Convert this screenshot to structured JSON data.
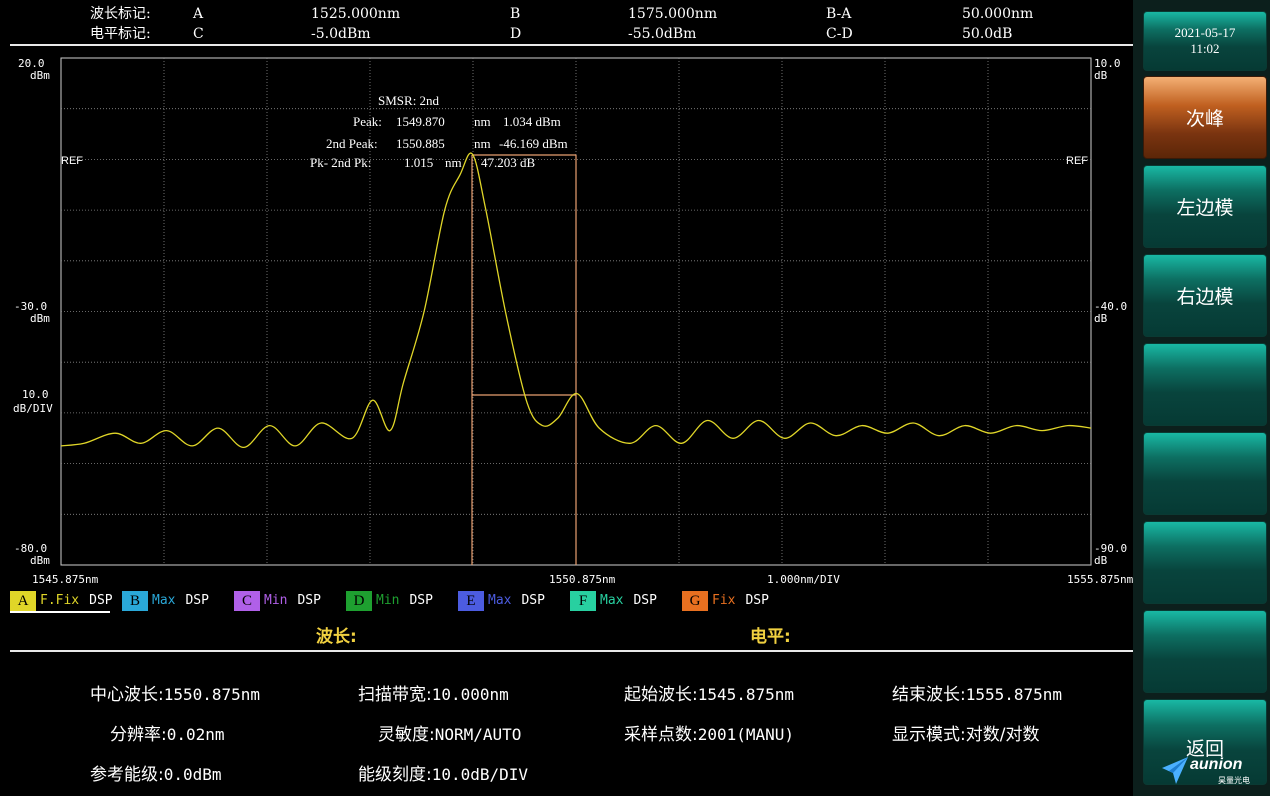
{
  "header": {
    "row1": {
      "label": "波长标记:",
      "m1_name": "A",
      "m1_value": "1525.000nm",
      "m2_name": "B",
      "m2_value": "1575.000nm",
      "diff_name": "B-A",
      "diff_value": "50.000nm"
    },
    "row2": {
      "label": "电平标记:",
      "m1_name": "C",
      "m1_value": "-5.0dBm",
      "m2_name": "D",
      "m2_value": "-55.0dBm",
      "diff_name": "C-D",
      "diff_value": "50.0dB"
    }
  },
  "plot": {
    "left_axis": {
      "top": "20.0",
      "top_unit": "dBm",
      "mid": "-30.0",
      "mid_unit": "dBm",
      "scale": "10.0",
      "scale_unit": "dB/DIV",
      "bottom": "-80.0",
      "bottom_unit": "dBm",
      "ref": "REF"
    },
    "right_axis": {
      "top": "10.0",
      "top_unit": "dB",
      "mid": "-40.0",
      "mid_unit": "dB",
      "bottom": "-90.0",
      "bottom_unit": "dB",
      "ref": "REF"
    },
    "x_axis": {
      "start": "1545.875nm",
      "center": "1550.875nm",
      "span_div": "1.000nm/DIV",
      "stop": "1555.875nm"
    },
    "annotation": {
      "title": "SMSR:  2nd",
      "peak_label": "Peak:",
      "peak_wl": "1549.870",
      "peak_unit": "nm",
      "peak_level": "1.034 dBm",
      "second_label": "2nd Peak:",
      "second_wl": "1550.885",
      "second_unit": "nm",
      "second_level": "-46.169 dBm",
      "diff_label": "Pk-  2nd Pk:",
      "diff_wl": "1.015",
      "diff_unit": "nm",
      "diff_level": "47.203 dB"
    },
    "trace_color": "#e0d628",
    "marker_color": "#e8a070"
  },
  "chart_data": {
    "type": "line",
    "x_range": [
      1545.875,
      1555.875
    ],
    "y_range": [
      -80,
      20
    ],
    "grid": true,
    "series": [
      {
        "x": [
          1545.875,
          1546.1,
          1546.4,
          1546.65,
          1546.9,
          1547.15,
          1547.4,
          1547.65,
          1547.9,
          1548.15,
          1548.4,
          1548.7,
          1548.9,
          1549.07,
          1549.2,
          1549.4,
          1549.6,
          1549.75,
          1549.87,
          1550.0,
          1550.2,
          1550.4,
          1550.55,
          1550.7,
          1550.885,
          1551.1,
          1551.4,
          1551.65,
          1551.9,
          1552.15,
          1552.4,
          1552.65,
          1552.9,
          1553.15,
          1553.4,
          1553.65,
          1553.9,
          1554.15,
          1554.4,
          1554.65,
          1554.9,
          1555.15,
          1555.4,
          1555.65,
          1555.875
        ],
        "y": [
          -56.5,
          -56.0,
          -54.0,
          -56.0,
          -53.5,
          -56.5,
          -53.0,
          -56.8,
          -52.5,
          -56.5,
          -52.0,
          -55.0,
          -47.5,
          -53.5,
          -44.0,
          -30.0,
          -10.0,
          -3.0,
          1.0,
          -10.0,
          -31.0,
          -48.0,
          -52.5,
          -51.0,
          -46.2,
          -53.0,
          -56.0,
          -52.5,
          -56.0,
          -51.5,
          -55.0,
          -51.5,
          -55.0,
          -52.0,
          -54.5,
          -52.5,
          -54.0,
          -52.0,
          -54.5,
          -52.5,
          -54.0,
          -52.5,
          -53.5,
          -52.5,
          -53.0
        ]
      }
    ]
  },
  "traces": [
    {
      "letter": "A",
      "mode": "F.Fix",
      "dsp": "DSP",
      "color": "#e0d628",
      "mode_color": "#e0d628",
      "active": true
    },
    {
      "letter": "B",
      "mode": "Max",
      "dsp": "DSP",
      "color": "#2aa8d8",
      "mode_color": "#2aa8d8",
      "active": false
    },
    {
      "letter": "C",
      "mode": "Min",
      "dsp": "DSP",
      "color": "#b060e8",
      "mode_color": "#b060e8",
      "active": false
    },
    {
      "letter": "D",
      "mode": "Min",
      "dsp": "DSP",
      "color": "#1ea030",
      "mode_color": "#1ea030",
      "active": false
    },
    {
      "letter": "E",
      "mode": "Max",
      "dsp": "DSP",
      "color": "#4c5ce0",
      "mode_color": "#4c5ce0",
      "active": false
    },
    {
      "letter": "F",
      "mode": "Max",
      "dsp": "DSP",
      "color": "#28d0a0",
      "mode_color": "#28d0a0",
      "active": false
    },
    {
      "letter": "G",
      "mode": "Fix",
      "dsp": "DSP",
      "color": "#e87020",
      "mode_color": "#e87020",
      "active": false
    }
  ],
  "readout": {
    "wavelength_label": "波长:",
    "level_label": "电平:"
  },
  "settings": {
    "center_wl_label": "中心波长:",
    "center_wl": "1550.875nm",
    "span_label": "扫描带宽:",
    "span": "10.000nm",
    "start_wl_label": "起始波长:",
    "start_wl": "1545.875nm",
    "stop_wl_label": "结束波长:",
    "stop_wl": "1555.875nm",
    "resolution_label": "分辨率:",
    "resolution": "0.02nm",
    "sensitivity_label": "灵敏度:",
    "sensitivity": "NORM/AUTO",
    "sampling_label": "采样点数:",
    "sampling": "2001(MANU)",
    "display_label": "显示模式:",
    "display": "对数/对数",
    "ref_level_label": "参考能级:",
    "ref_level": "0.0dBm",
    "level_scale_label": "能级刻度:",
    "level_scale": "10.0dB/DIV"
  },
  "menu": {
    "date": "2021-05-17",
    "time": "11:02",
    "btn_next_peak": "次峰",
    "btn_left_mode": "左边模",
    "btn_right_mode": "右边模",
    "btn_back": "返回",
    "logo_text": "aunion",
    "logo_sub": "昊量光电"
  }
}
